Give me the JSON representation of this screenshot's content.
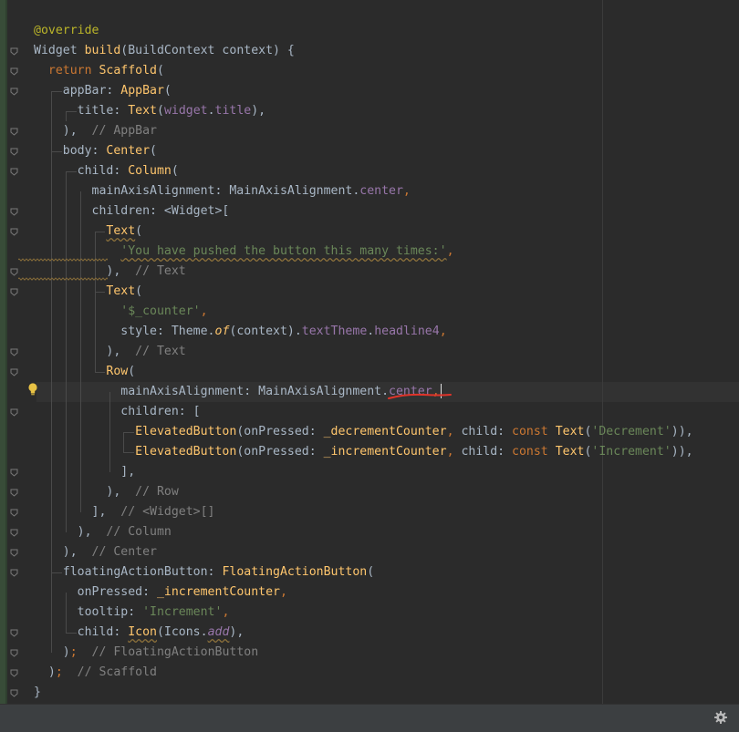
{
  "code_lines": [
    [
      {
        "t": "@override",
        "c": "ann"
      }
    ],
    [
      {
        "t": "Widget ",
        "c": ""
      },
      {
        "t": "build",
        "c": "cls"
      },
      {
        "t": "(BuildContext context) {",
        "c": ""
      }
    ],
    [
      {
        "t": "  ",
        "c": ""
      },
      {
        "t": "return ",
        "c": "kw"
      },
      {
        "t": "Scaffold",
        "c": "cls"
      },
      {
        "t": "(",
        "c": ""
      }
    ],
    [
      {
        "t": "    appBar: ",
        "c": ""
      },
      {
        "t": "AppBar",
        "c": "cls"
      },
      {
        "t": "(",
        "c": ""
      }
    ],
    [
      {
        "t": "      title: ",
        "c": ""
      },
      {
        "t": "Text",
        "c": "cls"
      },
      {
        "t": "(",
        "c": ""
      },
      {
        "t": "widget",
        "c": "fld"
      },
      {
        "t": ".",
        "c": ""
      },
      {
        "t": "title",
        "c": "fld"
      },
      {
        "t": "),",
        "c": ""
      }
    ],
    [
      {
        "t": "    ),",
        "c": ""
      },
      {
        "t": "  // AppBar",
        "c": "cmt"
      }
    ],
    [
      {
        "t": "    body: ",
        "c": ""
      },
      {
        "t": "Center",
        "c": "cls"
      },
      {
        "t": "(",
        "c": ""
      }
    ],
    [
      {
        "t": "      child: ",
        "c": ""
      },
      {
        "t": "Column",
        "c": "cls"
      },
      {
        "t": "(",
        "c": ""
      }
    ],
    [
      {
        "t": "        mainAxisAlignment: MainAxisAlignment.",
        "c": ""
      },
      {
        "t": "center",
        "c": "fld"
      },
      {
        "t": ",",
        "c": "kw"
      }
    ],
    [
      {
        "t": "        children: <Widget>[",
        "c": ""
      }
    ],
    [
      {
        "t": "          ",
        "c": ""
      },
      {
        "t": "Text",
        "c": "cls squig"
      },
      {
        "t": "(",
        "c": ""
      }
    ],
    [
      {
        "t": "            ",
        "c": ""
      },
      {
        "t": "'You have pushed the button this many times:'",
        "c": "str squig"
      },
      {
        "t": ",",
        "c": "kw"
      }
    ],
    [
      {
        "t": "          ),",
        "c": ""
      },
      {
        "t": "  // Text",
        "c": "cmt"
      }
    ],
    [
      {
        "t": "          ",
        "c": ""
      },
      {
        "t": "Text",
        "c": "cls"
      },
      {
        "t": "(",
        "c": ""
      }
    ],
    [
      {
        "t": "            ",
        "c": ""
      },
      {
        "t": "'$_counter'",
        "c": "str"
      },
      {
        "t": ",",
        "c": "kw"
      }
    ],
    [
      {
        "t": "            style: Theme.",
        "c": ""
      },
      {
        "t": "of",
        "c": "ital"
      },
      {
        "t": "(context).",
        "c": ""
      },
      {
        "t": "textTheme",
        "c": "fld"
      },
      {
        "t": ".",
        "c": ""
      },
      {
        "t": "headline4",
        "c": "fld"
      },
      {
        "t": ",",
        "c": "kw"
      }
    ],
    [
      {
        "t": "          ),",
        "c": ""
      },
      {
        "t": "  // Text",
        "c": "cmt"
      }
    ],
    [
      {
        "t": "          ",
        "c": ""
      },
      {
        "t": "Row",
        "c": "cls"
      },
      {
        "t": "(",
        "c": ""
      }
    ],
    [
      {
        "t": "            mainAxisAlignment: MainAxisAlignment.",
        "c": ""
      },
      {
        "t": "center",
        "c": "fld"
      },
      {
        "t": ",",
        "c": "kw"
      },
      {
        "t": "",
        "c": "caret"
      }
    ],
    [
      {
        "t": "            children: [",
        "c": ""
      }
    ],
    [
      {
        "t": "              ",
        "c": ""
      },
      {
        "t": "ElevatedButton",
        "c": "cls"
      },
      {
        "t": "(onPressed: ",
        "c": ""
      },
      {
        "t": "_decrementCounter",
        "c": "cls"
      },
      {
        "t": ", ",
        "c": "kw"
      },
      {
        "t": "child: ",
        "c": ""
      },
      {
        "t": "const ",
        "c": "kw"
      },
      {
        "t": "Text",
        "c": "cls"
      },
      {
        "t": "(",
        "c": ""
      },
      {
        "t": "'Decrement'",
        "c": "str"
      },
      {
        "t": ")),",
        "c": ""
      }
    ],
    [
      {
        "t": "              ",
        "c": ""
      },
      {
        "t": "ElevatedButton",
        "c": "cls"
      },
      {
        "t": "(onPressed: ",
        "c": ""
      },
      {
        "t": "_incrementCounter",
        "c": "cls"
      },
      {
        "t": ", ",
        "c": "kw"
      },
      {
        "t": "child: ",
        "c": ""
      },
      {
        "t": "const ",
        "c": "kw"
      },
      {
        "t": "Text",
        "c": "cls"
      },
      {
        "t": "(",
        "c": ""
      },
      {
        "t": "'Increment'",
        "c": "str"
      },
      {
        "t": ")),",
        "c": ""
      }
    ],
    [
      {
        "t": "            ],",
        "c": ""
      }
    ],
    [
      {
        "t": "          ),",
        "c": ""
      },
      {
        "t": "  // Row",
        "c": "cmt"
      }
    ],
    [
      {
        "t": "        ],",
        "c": ""
      },
      {
        "t": "  // <Widget>[]",
        "c": "cmt"
      }
    ],
    [
      {
        "t": "      ),",
        "c": ""
      },
      {
        "t": "  // Column",
        "c": "cmt"
      }
    ],
    [
      {
        "t": "    ),",
        "c": ""
      },
      {
        "t": "  // Center",
        "c": "cmt"
      }
    ],
    [
      {
        "t": "    floatingActionButton: ",
        "c": ""
      },
      {
        "t": "FloatingActionButton",
        "c": "cls"
      },
      {
        "t": "(",
        "c": ""
      }
    ],
    [
      {
        "t": "      onPressed: ",
        "c": ""
      },
      {
        "t": "_incrementCounter",
        "c": "cls"
      },
      {
        "t": ",",
        "c": "kw"
      }
    ],
    [
      {
        "t": "      tooltip: ",
        "c": ""
      },
      {
        "t": "'Increment'",
        "c": "str"
      },
      {
        "t": ",",
        "c": "kw"
      }
    ],
    [
      {
        "t": "      child: ",
        "c": ""
      },
      {
        "t": "Icon",
        "c": "cls squig"
      },
      {
        "t": "(Icons.",
        "c": ""
      },
      {
        "t": "add",
        "c": "italfld squig"
      },
      {
        "t": "),",
        "c": ""
      }
    ],
    [
      {
        "t": "    )",
        "c": ""
      },
      {
        "t": ";",
        "c": "kw"
      },
      {
        "t": "  // FloatingActionButton",
        "c": "cmt"
      }
    ],
    [
      {
        "t": "  )",
        "c": ""
      },
      {
        "t": ";",
        "c": "kw"
      },
      {
        "t": "  // Scaffold",
        "c": "cmt"
      }
    ],
    [
      {
        "t": "}",
        "c": ""
      }
    ]
  ],
  "fold_rows": [
    1,
    2,
    3,
    5,
    6,
    7,
    9,
    10,
    12,
    13,
    16,
    17,
    19,
    22,
    23,
    24,
    25,
    26,
    27,
    30,
    31,
    32,
    33
  ],
  "current_line": 18,
  "colors": {
    "background": "#2b2b2b",
    "text": "#a9b7c6",
    "keyword": "#cc7832",
    "function": "#ffc66d",
    "string": "#6a8759",
    "field": "#9876aa",
    "comment": "#808080",
    "annotation": "#bbb529",
    "status_bar": "#3c3f41"
  },
  "icons": {
    "gutter_fold": "fold-marker-icon",
    "intention": "lightbulb-icon",
    "status": "gear-icon"
  }
}
